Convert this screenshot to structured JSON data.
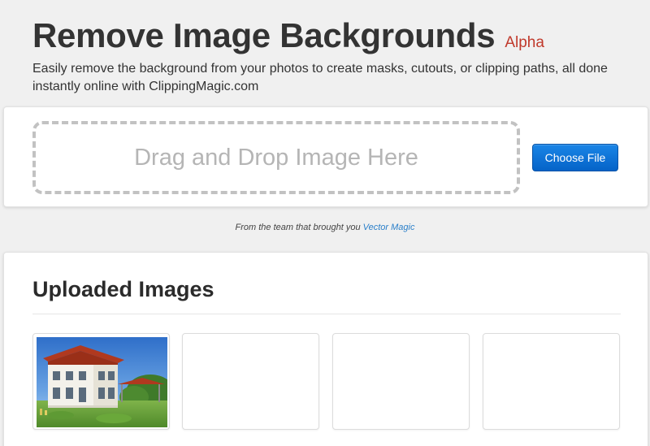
{
  "hero": {
    "title": "Remove Image Backgrounds",
    "badge": "Alpha",
    "description": "Easily remove the background from your photos to create masks, cutouts, or clipping paths, all done instantly online with ClippingMagic.com"
  },
  "upload": {
    "dropzone_text": "Drag and Drop Image Here",
    "choose_button": "Choose File"
  },
  "credit": {
    "prefix": "From the team that brought you",
    "link": "Vector Magic"
  },
  "uploaded": {
    "title": "Uploaded Images",
    "thumbnails": [
      {
        "content": "house-photo"
      },
      {
        "content": "empty"
      },
      {
        "content": "empty"
      },
      {
        "content": "empty"
      }
    ]
  },
  "colors": {
    "badge": "#c0392b",
    "button": "#0563c8",
    "link": "#2a7fc9",
    "background": "#f0f0f0"
  }
}
